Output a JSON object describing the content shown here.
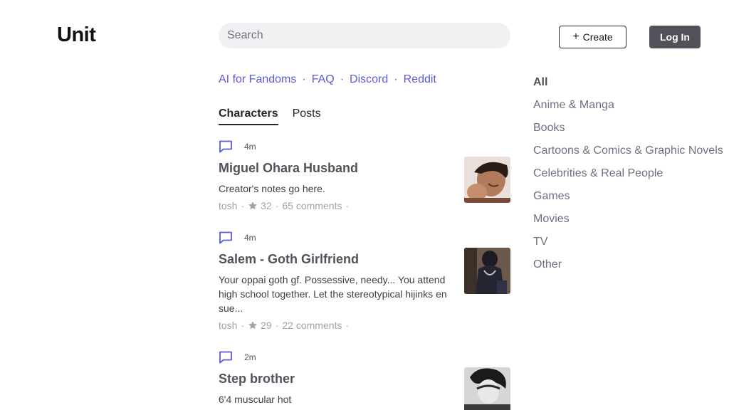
{
  "header": {
    "logo": "Unit",
    "search_placeholder": "Search",
    "create_label": "Create",
    "login_label": "Log In"
  },
  "top_links": [
    "AI for Fandoms",
    "FAQ",
    "Discord",
    "Reddit"
  ],
  "tabs": [
    {
      "label": "Characters",
      "active": true
    },
    {
      "label": "Posts",
      "active": false
    }
  ],
  "cards": [
    {
      "time": "4m",
      "title": "Miguel Ohara Husband",
      "description": "Creator's notes go here.",
      "author": "tosh",
      "stars": "32",
      "comments": "65 comments",
      "thumb_icon": "anime-man-portrait"
    },
    {
      "time": "4m",
      "title": "Salem - Goth Girlfriend",
      "description": "Your oppai goth gf. Possessive, needy... You attend high school together. Let the stereotypical hijinks ensue...",
      "author": "tosh",
      "stars": "29",
      "comments": "22 comments",
      "thumb_icon": "goth-girl-portrait"
    },
    {
      "time": "2m",
      "title": "Step brother",
      "description": "6'4 muscular hot",
      "author": "",
      "stars": "",
      "comments": "",
      "thumb_icon": "monochrome-man-portrait"
    }
  ],
  "categories": [
    {
      "label": "All",
      "active": true
    },
    {
      "label": "Anime & Manga",
      "active": false
    },
    {
      "label": "Books",
      "active": false
    },
    {
      "label": "Cartoons & Comics & Graphic Novels",
      "active": false
    },
    {
      "label": "Celebrities & Real People",
      "active": false
    },
    {
      "label": "Games",
      "active": false
    },
    {
      "label": "Movies",
      "active": false
    },
    {
      "label": "TV",
      "active": false
    },
    {
      "label": "Other",
      "active": false
    }
  ],
  "colors": {
    "link": "#5b5bd6",
    "login_bg": "#52525b",
    "search_bg": "#f1f1f3"
  }
}
